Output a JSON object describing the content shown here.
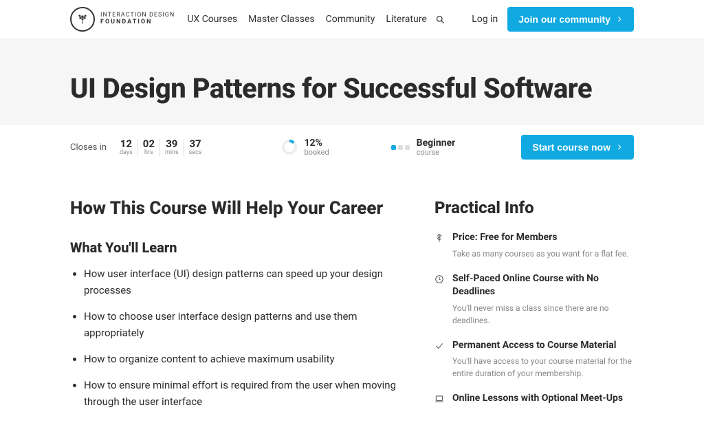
{
  "brand": {
    "line1": "INTERACTION DESIGN",
    "line2": "FOUNDATION"
  },
  "nav": {
    "items": [
      "UX Courses",
      "Master Classes",
      "Community",
      "Literature"
    ]
  },
  "header": {
    "login": "Log in",
    "cta": "Join our community"
  },
  "page": {
    "title": "UI Design Patterns for Successful Software"
  },
  "status": {
    "closes_label": "Closes in",
    "countdown": [
      {
        "num": "12",
        "lab": "days"
      },
      {
        "num": "02",
        "lab": "hrs"
      },
      {
        "num": "39",
        "lab": "mins"
      },
      {
        "num": "37",
        "lab": "secs"
      }
    ],
    "booked_pct": "12%",
    "booked_lbl": "booked",
    "level": "Beginner",
    "level_lbl": "course",
    "start_btn": "Start course now"
  },
  "career": {
    "title": "How This Course Will Help Your Career",
    "learn_title": "What You'll Learn",
    "points": [
      "How user interface (UI) design patterns can speed up your design processes",
      "How to choose user interface design patterns and use them appropriately",
      "How to organize content to achieve maximum usability",
      "How to ensure minimal effort is required from the user when moving through the user interface"
    ]
  },
  "info": {
    "title": "Practical Info",
    "items": [
      {
        "icon": "dollar",
        "title": "Price: Free for Members",
        "desc": "Take as many courses as you want for a flat fee."
      },
      {
        "icon": "clock",
        "title": "Self-Paced Online Course with No Deadlines",
        "desc": "You'll never miss a class since there are no deadlines."
      },
      {
        "icon": "check",
        "title": "Permanent Access to Course Material",
        "desc": "You'll have access to your course material for the entire duration of your membership."
      },
      {
        "icon": "laptop",
        "title": "Online Lessons with Optional Meet-Ups",
        "desc": ""
      }
    ]
  }
}
